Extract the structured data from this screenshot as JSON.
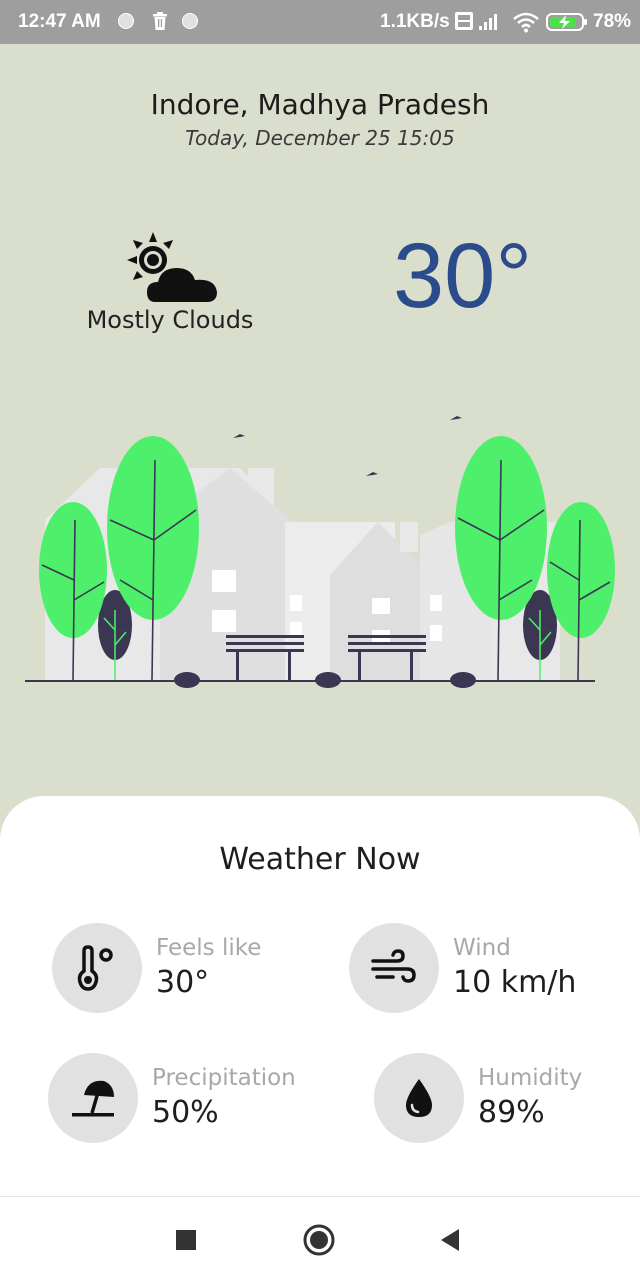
{
  "status_bar": {
    "time": "12:47 AM",
    "net_speed": "1.1KB/s",
    "battery_pct": "78%",
    "icons": [
      "notification-dot-icon",
      "trash-icon",
      "notification-dot-icon",
      "volte-icon",
      "signal-icon",
      "wifi-icon",
      "battery-charging-icon"
    ]
  },
  "location": {
    "city": "Indore, Madhya Pradesh",
    "datetime": "Today, December 25 15:05"
  },
  "current": {
    "condition": "Mostly Clouds",
    "condition_icon": "sun-cloud-icon",
    "temperature": "30°",
    "temperature_color": "#2b4c8c"
  },
  "illustration": {
    "name": "city-park-scene",
    "tree_color": "#4ef06b",
    "building_color": "#e5e5e5"
  },
  "weather_now": {
    "title": "Weather Now",
    "stats": [
      {
        "label": "Feels like",
        "value": "30°",
        "icon": "thermometer-icon"
      },
      {
        "label": "Wind",
        "value": "10 km/h",
        "icon": "wind-icon"
      },
      {
        "label": "Precipitation",
        "value": "50%",
        "icon": "beach-umbrella-icon"
      },
      {
        "label": "Humidity",
        "value": "89%",
        "icon": "water-drop-icon"
      }
    ]
  },
  "nav_bar": {
    "buttons": [
      "recents-square-icon",
      "home-circle-icon",
      "back-triangle-icon"
    ]
  },
  "colors": {
    "background": "#dadfcd",
    "card": "#ffffff",
    "icon_circle": "#e1e1e1",
    "label_gray": "#a8a8a8"
  }
}
